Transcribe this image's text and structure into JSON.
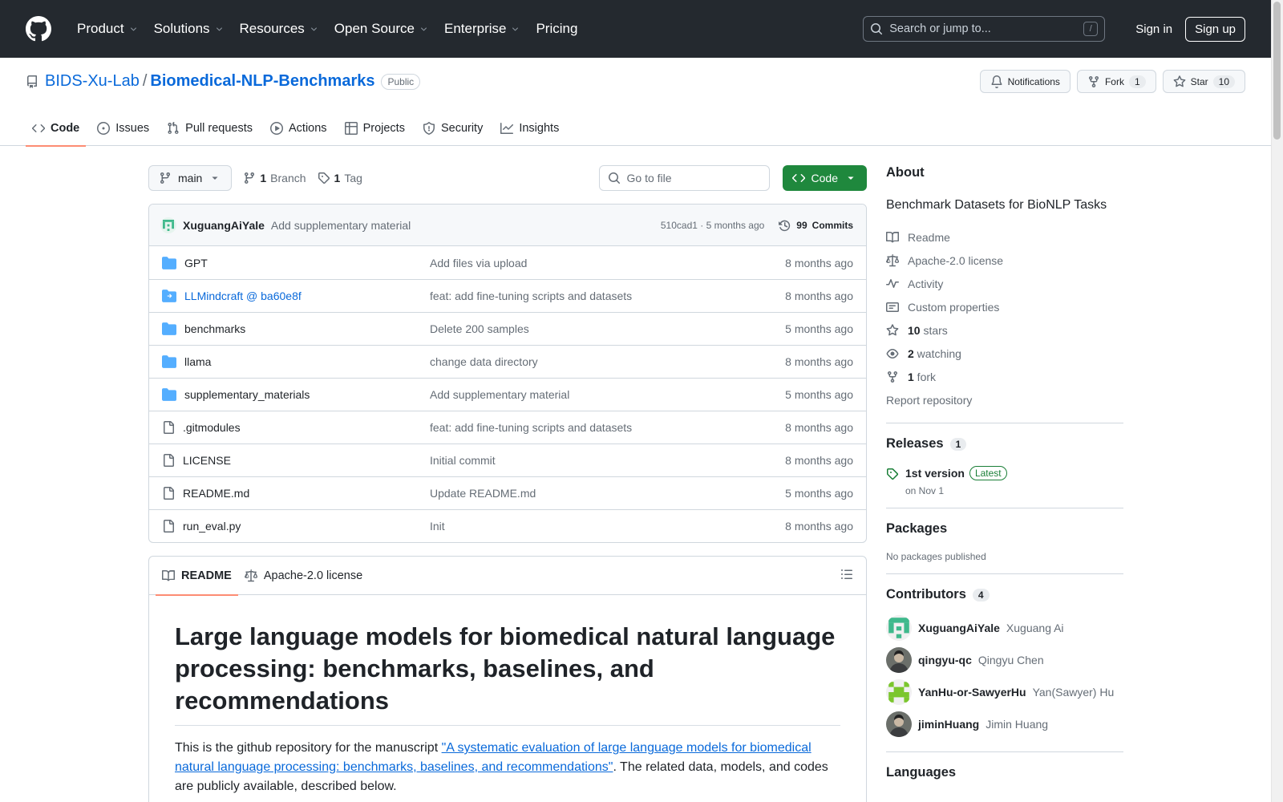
{
  "header": {
    "nav": [
      {
        "label": "Product",
        "dropdown": true
      },
      {
        "label": "Solutions",
        "dropdown": true
      },
      {
        "label": "Resources",
        "dropdown": true
      },
      {
        "label": "Open Source",
        "dropdown": true
      },
      {
        "label": "Enterprise",
        "dropdown": true
      },
      {
        "label": "Pricing",
        "dropdown": false
      }
    ],
    "search_placeholder": "Search or jump to...",
    "search_key": "/",
    "sign_in": "Sign in",
    "sign_up": "Sign up"
  },
  "repo": {
    "owner": "BIDS-Xu-Lab",
    "separator": "/",
    "name": "Biomedical-NLP-Benchmarks",
    "visibility": "Public",
    "notifications_label": "Notifications",
    "fork_label": "Fork",
    "fork_count": "1",
    "star_label": "Star",
    "star_count": "10",
    "tabs": [
      {
        "label": "Code",
        "icon": "code-icon",
        "active": true
      },
      {
        "label": "Issues",
        "icon": "issue-icon",
        "active": false
      },
      {
        "label": "Pull requests",
        "icon": "pull-request-icon",
        "active": false
      },
      {
        "label": "Actions",
        "icon": "play-icon",
        "active": false
      },
      {
        "label": "Projects",
        "icon": "table-icon",
        "active": false
      },
      {
        "label": "Security",
        "icon": "shield-icon",
        "active": false
      },
      {
        "label": "Insights",
        "icon": "graph-icon",
        "active": false
      }
    ]
  },
  "toolbar": {
    "branch": "main",
    "branch_count": "1",
    "branch_label": "Branch",
    "tag_count": "1",
    "tag_label": "Tag",
    "goto_placeholder": "Go to file",
    "code_button": "Code"
  },
  "latest_commit": {
    "author": "XuguangAiYale",
    "message": "Add supplementary material",
    "meta": "510cad1 · 5 months ago",
    "commits_count": "99",
    "commits_label": "Commits"
  },
  "files": [
    {
      "name": "GPT",
      "type": "folder",
      "message": "Add files via upload",
      "time": "8 months ago"
    },
    {
      "name": "LLMindcraft @ ba60e8f",
      "type": "submodule",
      "message": "feat: add fine-tuning scripts and datasets",
      "time": "8 months ago"
    },
    {
      "name": "benchmarks",
      "type": "folder",
      "message": "Delete 200 samples",
      "time": "5 months ago"
    },
    {
      "name": "llama",
      "type": "folder",
      "message": "change data directory",
      "time": "8 months ago"
    },
    {
      "name": "supplementary_materials",
      "type": "folder",
      "message": "Add supplementary material",
      "time": "5 months ago"
    },
    {
      "name": ".gitmodules",
      "type": "file",
      "message": "feat: add fine-tuning scripts and datasets",
      "time": "8 months ago"
    },
    {
      "name": "LICENSE",
      "type": "file",
      "message": "Initial commit",
      "time": "8 months ago"
    },
    {
      "name": "README.md",
      "type": "file",
      "message": "Update README.md",
      "time": "5 months ago"
    },
    {
      "name": "run_eval.py",
      "type": "file",
      "message": "Init",
      "time": "8 months ago"
    }
  ],
  "readme": {
    "tab_readme": "README",
    "tab_license": "Apache-2.0 license",
    "heading": "Large language models for biomedical natural language processing: benchmarks, baselines, and recommendations",
    "intro_before": "This is the github repository for the manuscript ",
    "intro_link": "\"A systematic evaluation of large language models for biomedical natural language processing: benchmarks, baselines, and recommendations\"",
    "intro_after": ". The related data, models, and codes are publicly available, described below."
  },
  "about": {
    "title": "About",
    "description": "Benchmark Datasets for BioNLP Tasks",
    "items": [
      {
        "icon": "book-icon",
        "bold": "",
        "text": "Readme"
      },
      {
        "icon": "law-icon",
        "bold": "",
        "text": "Apache-2.0 license"
      },
      {
        "icon": "pulse-icon",
        "bold": "",
        "text": "Activity"
      },
      {
        "icon": "note-icon",
        "bold": "",
        "text": "Custom properties"
      },
      {
        "icon": "star-icon",
        "bold": "10",
        "text": " stars"
      },
      {
        "icon": "eye-icon",
        "bold": "2",
        "text": " watching"
      },
      {
        "icon": "fork-icon",
        "bold": "1",
        "text": " fork"
      }
    ],
    "report": "Report repository"
  },
  "releases": {
    "title": "Releases",
    "count": "1",
    "name": "1st version",
    "badge": "Latest",
    "date": "on Nov 1"
  },
  "packages": {
    "title": "Packages",
    "text": "No packages published"
  },
  "contributors": {
    "title": "Contributors",
    "count": "4",
    "list": [
      {
        "login": "XuguangAiYale",
        "name": "Xuguang Ai",
        "avatar": "identicon-green"
      },
      {
        "login": "qingyu-qc",
        "name": "Qingyu Chen",
        "avatar": "photo"
      },
      {
        "login": "YanHu-or-SawyerHu",
        "name": "Yan(Sawyer) Hu",
        "avatar": "identicon-lime"
      },
      {
        "login": "jiminHuang",
        "name": "Jimin Huang",
        "avatar": "photo"
      }
    ]
  },
  "languages": {
    "title": "Languages"
  },
  "colors": {
    "header_bg": "#24292f",
    "link": "#0969da",
    "green_button": "#1f883d",
    "tab_underline": "#fd8c73"
  }
}
